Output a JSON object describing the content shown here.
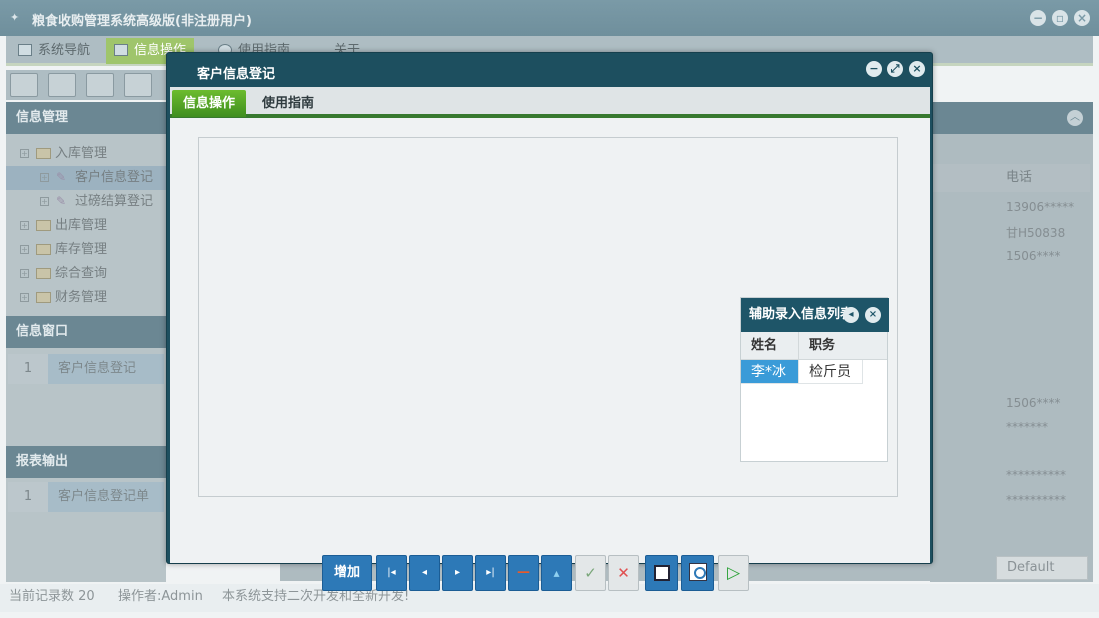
{
  "app": {
    "title": "粮食收购管理系统高级版(非注册用户)"
  },
  "main_tabs": [
    {
      "label": "系统导航"
    },
    {
      "label": "信息操作"
    },
    {
      "label": "使用指南"
    },
    {
      "label": "关于"
    }
  ],
  "sidebar": {
    "info_manage_title": "信息管理",
    "tree": [
      {
        "label": "入库管理"
      },
      {
        "label": "客户信息登记"
      },
      {
        "label": "过磅结算登记"
      },
      {
        "label": "出库管理"
      },
      {
        "label": "库存管理"
      },
      {
        "label": "综合查询"
      },
      {
        "label": "财务管理"
      }
    ],
    "info_window_title": "信息窗口",
    "info_window_items": [
      {
        "num": "1",
        "label": "客户信息登记"
      }
    ],
    "report_title": "报表输出",
    "report_items": [
      {
        "num": "1",
        "label": "客户信息登记单"
      }
    ]
  },
  "background_table": {
    "phone_header": "电话",
    "phones": [
      "13906*****",
      "甘H50838",
      "1506****",
      "1506****",
      "*******",
      "**********",
      "**********"
    ],
    "default_select": "Default"
  },
  "status_bar": {
    "record_count": "当前记录数 20",
    "operator": "操作者:Admin",
    "notice": "本系统支持二次开发和全新开发!"
  },
  "dialog": {
    "title": "客户信息登记",
    "tabs": [
      {
        "label": "信息操作"
      },
      {
        "label": "使用指南"
      }
    ],
    "assist_panel": {
      "title": "辅助录入信息列表",
      "columns": [
        "姓名",
        "职务"
      ],
      "rows": [
        {
          "name": "李*冰",
          "role": "检斤员"
        }
      ]
    },
    "buttons": {
      "add_label": "增加",
      "first_glyph": "|◂",
      "prev_glyph": "◂",
      "next_glyph": "▸",
      "last_glyph": "▸|",
      "delete_glyph": "—",
      "up_glyph": "▴",
      "confirm_glyph": "✓",
      "cancel_glyph": "✕",
      "run_glyph": "▷"
    }
  },
  "colors": {
    "dialog_bg": "#1d4f5f",
    "accent_green": "#37792f",
    "button_blue": "#2d79b7"
  }
}
